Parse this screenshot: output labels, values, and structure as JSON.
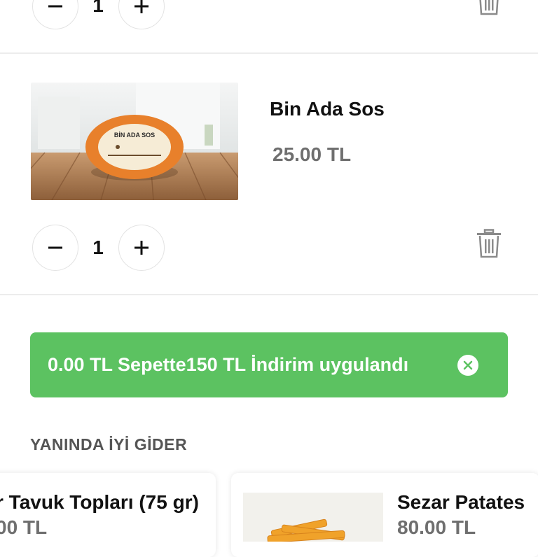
{
  "cart_items": [
    {
      "quantity": "1"
    },
    {
      "title": "Bin Ada Sos",
      "price": "25.00 TL",
      "quantity": "1",
      "image_label": "BİN ADA SOS"
    }
  ],
  "discount_banner": {
    "text": "0.00 TL Sepette150 TL İndirim uygulandı"
  },
  "suggestions": {
    "title": "YANINDA İYİ GİDER",
    "items": [
      {
        "title": "r Tavuk Topları (75 gr)",
        "price": "00 TL"
      },
      {
        "title": "Sezar Patates",
        "price": "80.00 TL"
      }
    ]
  },
  "colors": {
    "banner": "#5cc261",
    "price": "#6f6f6f",
    "icon": "#8a8a8a"
  },
  "icons": [
    "minus-icon",
    "plus-icon",
    "trash-icon",
    "close-circle-icon"
  ]
}
